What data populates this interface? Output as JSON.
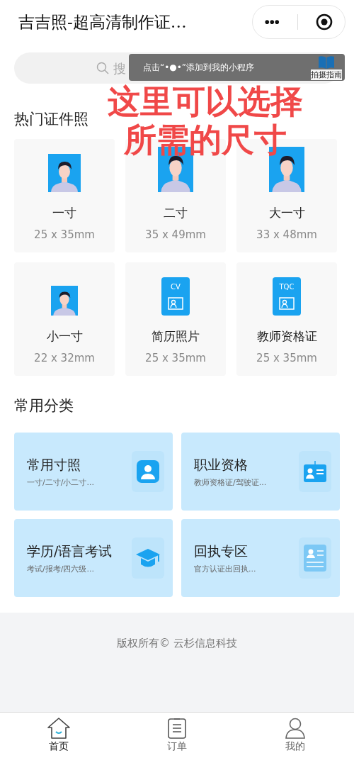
{
  "header": {
    "title": "吉吉照-超高清制作证…",
    "more_button": "•••"
  },
  "search": {
    "placeholder": "搜"
  },
  "tooltip": {
    "text": "点击“•●•”添加到我的小程序"
  },
  "guide": {
    "label": "拍摄指南"
  },
  "caption": {
    "lines": [
      "这里可以选择",
      "所需的尺寸"
    ]
  },
  "hot_section": {
    "title": "热门证件照",
    "items": [
      {
        "kind": "photo",
        "name": "一寸",
        "size": "25 x 35mm"
      },
      {
        "kind": "photo",
        "name": "二寸",
        "size": "35 x 49mm"
      },
      {
        "kind": "photo",
        "name": "大一寸",
        "size": "33 x 48mm"
      },
      {
        "kind": "photo",
        "name": "小一寸",
        "size": "22 x 32mm"
      },
      {
        "kind": "badge",
        "badge_text": "CV",
        "name": "简历照片",
        "size": "25 x 35mm"
      },
      {
        "kind": "badge",
        "badge_text": "TQC",
        "name": "教师资格证",
        "size": "25 x 35mm"
      }
    ]
  },
  "category_section": {
    "title": "常用分类",
    "items": [
      {
        "kind": "portrait",
        "title": "常用寸照",
        "subtitle": "一寸/二寸/小二寸..."
      },
      {
        "kind": "idcard",
        "title": "职业资格",
        "subtitle": "教师资格证/驾驶证..."
      },
      {
        "kind": "cap",
        "title": "学历/语言考试",
        "subtitle": "考试/报考/四六级..."
      },
      {
        "kind": "document",
        "title": "回执专区",
        "subtitle": "官方认证出回执..."
      }
    ]
  },
  "footer": {
    "copyright": "版权所有© 云杉信息科技"
  },
  "tabbar": [
    {
      "kind": "home",
      "label": "首页",
      "selected": true
    },
    {
      "kind": "orders",
      "label": "订单",
      "selected": false
    },
    {
      "kind": "me",
      "label": "我的",
      "selected": false
    }
  ]
}
